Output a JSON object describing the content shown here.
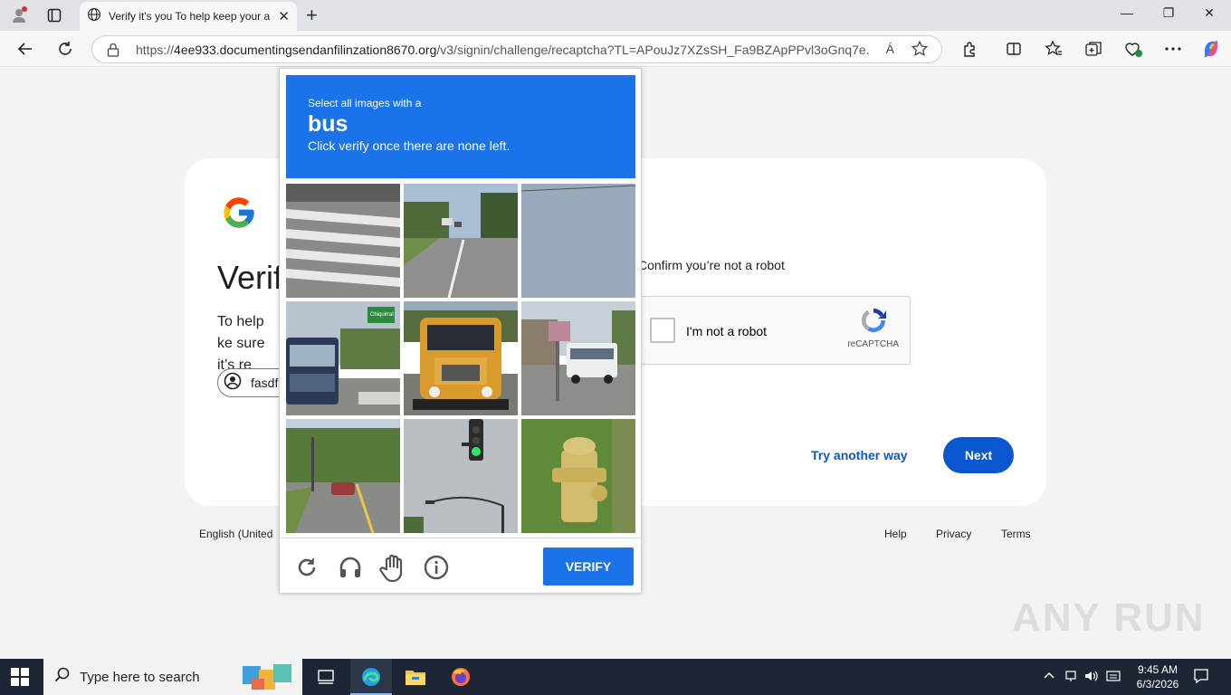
{
  "browser": {
    "tab_title": "Verify it's you To help keep your a",
    "url_prefix": "https://",
    "url_host": "4ee933.documentingsendanfilinzation8670.org",
    "url_path": "/v3/signin/challenge/recaptcha?TL=APouJz7XZsSH_Fa9BZApPPvl3oGnq7e...",
    "read_aloud": "Á"
  },
  "page": {
    "title": "Verif",
    "description": "To help ke sure it’s re",
    "account_email": "fasdf",
    "confirm_text": "Confirm you’re not a robot",
    "recaptcha_label": "I'm not a robot",
    "recaptcha_brand": "reCAPTCHA",
    "try_another_way": "Try another way",
    "next_button": "Next",
    "footer_language": "English (United",
    "footer_help": "Help",
    "footer_privacy": "Privacy",
    "footer_terms": "Terms"
  },
  "challenge": {
    "instruction_line1": "Select all images with a",
    "target_object": "bus",
    "instruction_line3": "Click verify once there are none left.",
    "verify_button": "VERIFY",
    "tiles": [
      "crosswalk",
      "road with cars",
      "sky",
      "bus",
      "school bus",
      "bus on street",
      "street with car",
      "traffic light",
      "fire hydrant"
    ],
    "tile_sign_text": "Chiquirral"
  },
  "watermark": "ANY RUN",
  "taskbar": {
    "search_placeholder": "Type here to search",
    "time": "9:45 AM",
    "date": "6/3/2026"
  },
  "colors": {
    "challenge_blue": "#1a73e8",
    "google_blue": "#0b57d0"
  }
}
